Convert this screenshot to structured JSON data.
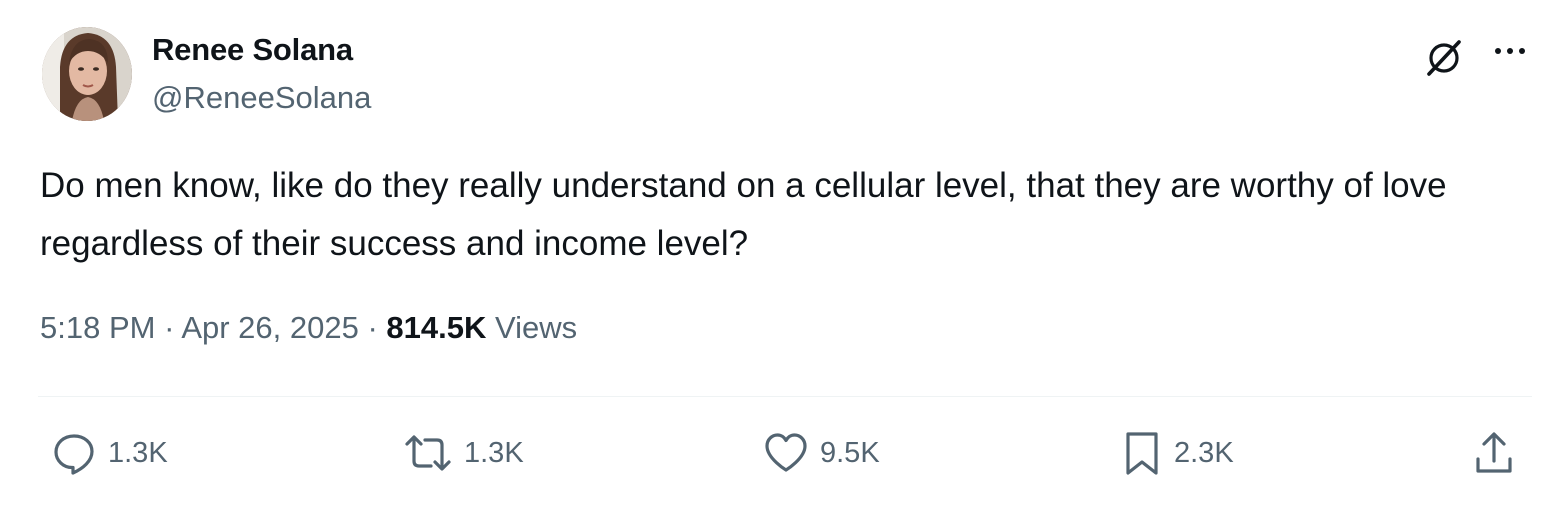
{
  "author": {
    "display_name": "Renee Solana",
    "handle": "@ReneeSolana",
    "avatar_icon": "profile-photo"
  },
  "header_actions": {
    "grok_icon": "grok-icon",
    "more_icon": "more-dots-icon"
  },
  "tweet": {
    "text": "Do men know, like do they really understand on a cellular level, that they are worthy of love regardless of their success and income level?"
  },
  "meta": {
    "time": "5:18 PM",
    "separator": "·",
    "date": "Apr 26, 2025",
    "views_count": "814.5K",
    "views_label": "Views"
  },
  "actions": {
    "reply_count": "1.3K",
    "repost_count": "1.3K",
    "like_count": "9.5K",
    "bookmark_count": "2.3K"
  },
  "colors": {
    "primary_text": "#0f1419",
    "secondary_text": "#536471",
    "divider": "#eff3f4"
  }
}
